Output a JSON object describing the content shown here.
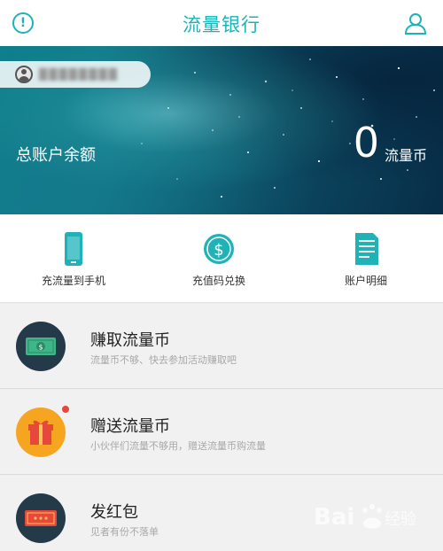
{
  "header": {
    "title": "流量银行",
    "left_icon": "info-icon",
    "right_icon": "user-icon"
  },
  "banner": {
    "account_name": "████████",
    "balance_label": "总账户余额",
    "balance_value": "0",
    "balance_unit": "流量币"
  },
  "actions": [
    {
      "label": "充流量到手机",
      "icon": "phone-icon"
    },
    {
      "label": "充值码兑换",
      "icon": "dollar-coin-icon"
    },
    {
      "label": "账户明细",
      "icon": "document-icon"
    }
  ],
  "list": [
    {
      "title": "赚取流量币",
      "subtitle": "流量币不够、快去参加活动赚取吧",
      "icon": "money-bill-icon"
    },
    {
      "title": "赠送流量币",
      "subtitle": "小伙伴们流量不够用，赠送流量币购流量",
      "icon": "gift-icon",
      "has_badge": true
    },
    {
      "title": "发红包",
      "subtitle": "见者有份不落单",
      "icon": "red-envelope-icon"
    }
  ],
  "colors": {
    "accent": "#1fb3b8",
    "badge": "#e8473c",
    "gift_circle": "#f6a520",
    "dark_circle": "#243a49"
  }
}
